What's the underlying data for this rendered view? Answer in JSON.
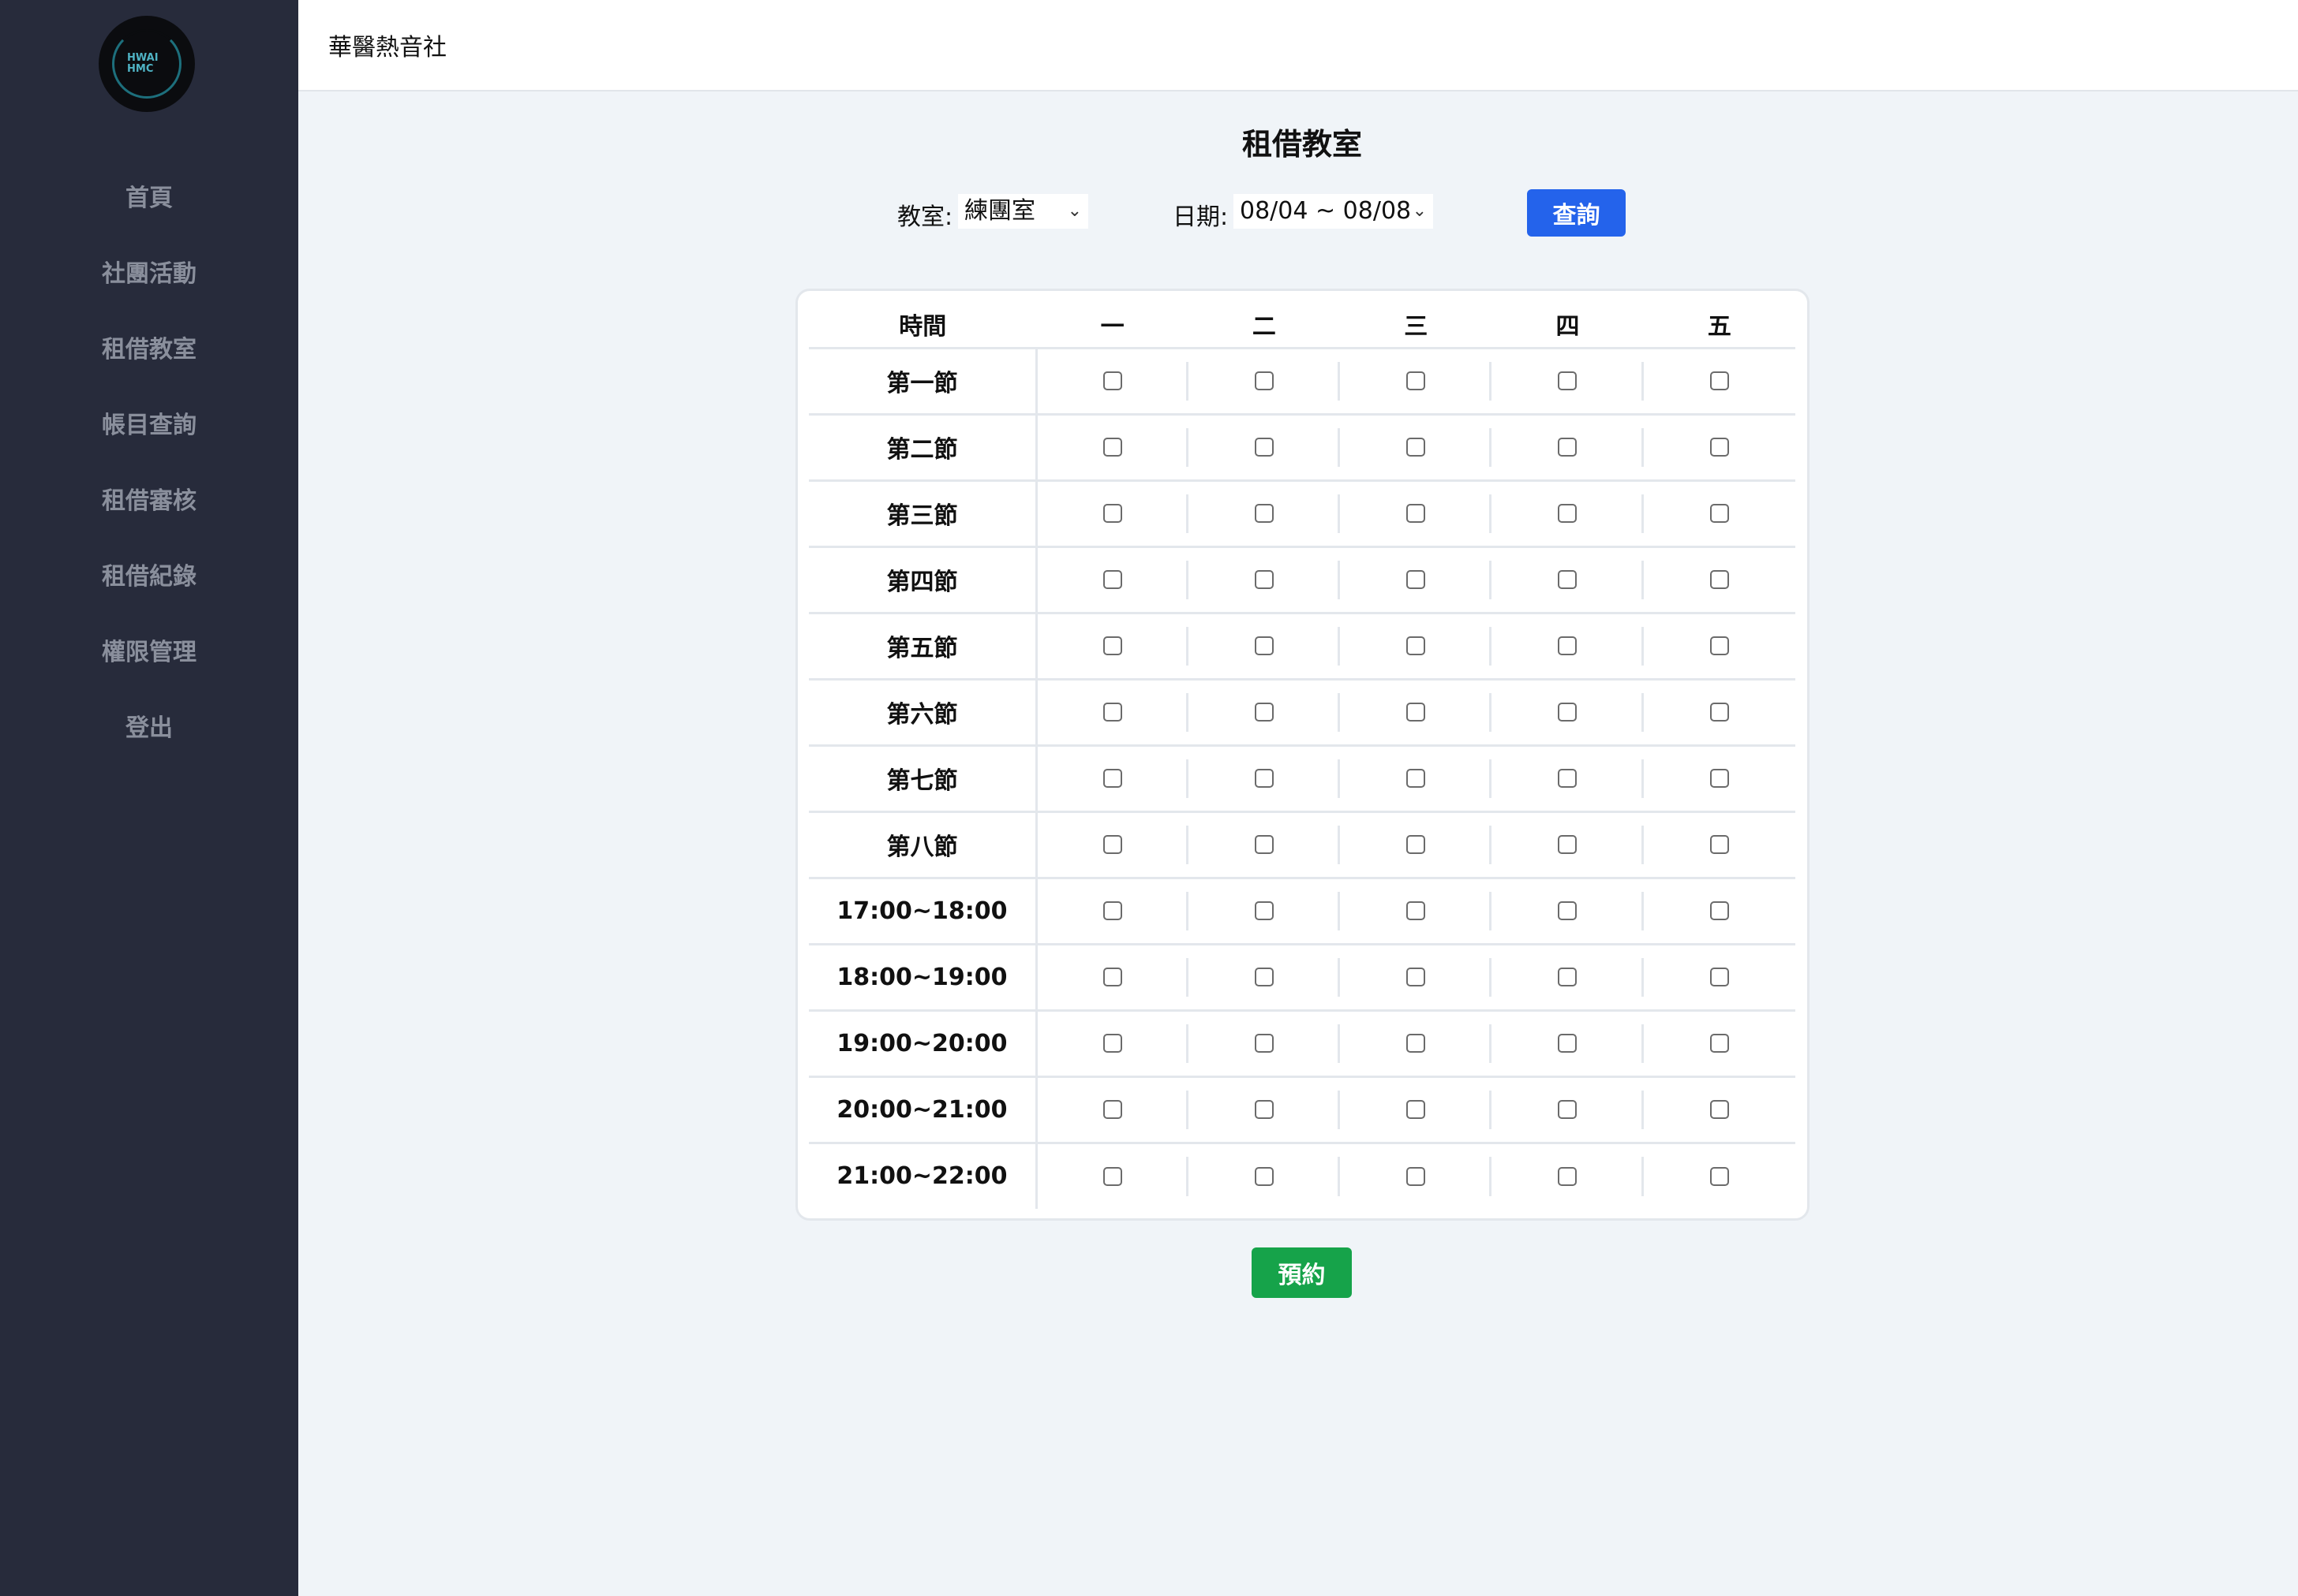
{
  "logo": {
    "text_line1": "HWAI",
    "text_line2": "HMC"
  },
  "sidebar": {
    "items": [
      {
        "label": "首頁"
      },
      {
        "label": "社團活動"
      },
      {
        "label": "租借教室"
      },
      {
        "label": "帳目查詢"
      },
      {
        "label": "租借審核"
      },
      {
        "label": "租借紀錄"
      },
      {
        "label": "權限管理"
      },
      {
        "label": "登出"
      }
    ]
  },
  "header": {
    "title": "華醫熱音社"
  },
  "main": {
    "title": "租借教室",
    "filters": {
      "room_label": "教室:",
      "room_value": "練團室",
      "date_label": "日期:",
      "date_value": "08/04 ~ 08/08",
      "query_label": "查詢"
    },
    "table": {
      "headers": [
        "時間",
        "一",
        "二",
        "三",
        "四",
        "五"
      ],
      "rows": [
        "第一節",
        "第二節",
        "第三節",
        "第四節",
        "第五節",
        "第六節",
        "第七節",
        "第八節",
        "17:00~18:00",
        "18:00~19:00",
        "19:00~20:00",
        "20:00~21:00",
        "21:00~22:00"
      ]
    },
    "reserve_label": "預約"
  },
  "colors": {
    "sidebar_bg": "#272b3b",
    "primary": "#2463eb",
    "success": "#16a34a",
    "page_bg": "#f0f4f8"
  }
}
